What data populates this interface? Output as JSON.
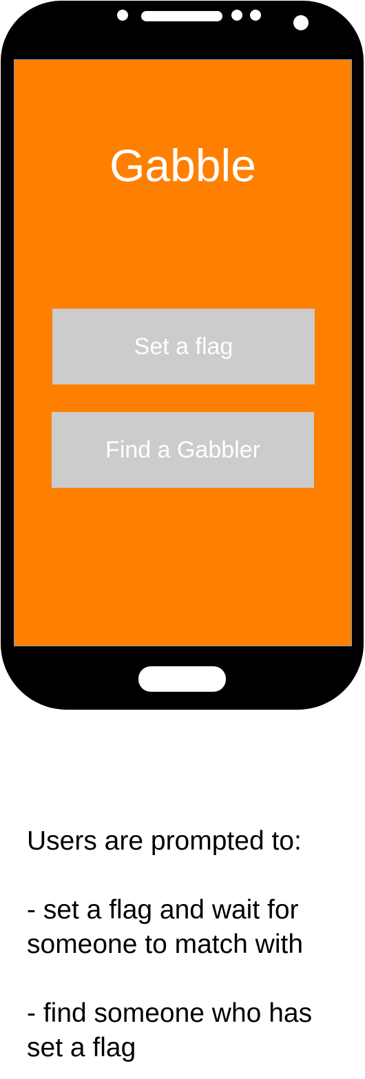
{
  "app": {
    "title": "Gabble"
  },
  "buttons": {
    "set_flag": "Set a flag",
    "find_gabbler": "Find a Gabbler"
  },
  "caption": {
    "intro": "Users are prompted to:",
    "item1_line1": "- set a flag and wait for",
    "item1_line2": "someone to match with",
    "item2_line1": "- find someone who has",
    "item2_line2": "set a flag"
  },
  "colors": {
    "screen_background": "#ff7f00",
    "button_background": "#cccccc",
    "phone_body": "#000000"
  }
}
